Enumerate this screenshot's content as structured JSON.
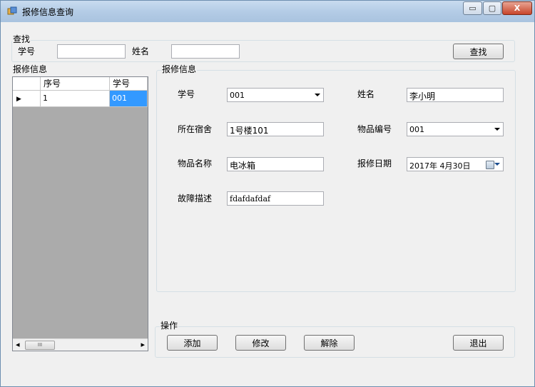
{
  "window": {
    "title": "报修信息查询",
    "controls": {
      "minimize": "▭",
      "maximize": "▢",
      "close": "X"
    }
  },
  "search": {
    "group_label": "查找",
    "student_id_label": "学号",
    "student_id_value": "",
    "name_label": "姓名",
    "name_value": "",
    "search_button": "查找"
  },
  "list": {
    "group_label": "报修信息",
    "columns": [
      "序号",
      "学号"
    ],
    "rows": [
      {
        "seq": "1",
        "student_id": "001"
      }
    ],
    "row_indicator": "▶",
    "scroll_left": "◂",
    "scroll_right": "▸",
    "scroll_thumb": "III"
  },
  "detail": {
    "group_label": "报修信息",
    "student_id_label": "学号",
    "student_id_value": "001",
    "name_label": "姓名",
    "name_value": "李小明",
    "dorm_label": "所在宿舍",
    "dorm_value": "1号楼101",
    "item_code_label": "物品编号",
    "item_code_value": "001",
    "item_name_label": "物品名称",
    "item_name_value": "电冰箱",
    "repair_date_label": "报修日期",
    "repair_date_value": "2017年  4月30日",
    "fault_label": "故障描述",
    "fault_value": "fdafdafdaf"
  },
  "actions": {
    "group_label": "操作",
    "add": "添加",
    "edit": "修改",
    "delete": "解除",
    "exit": "退出"
  },
  "colors": {
    "selection": "#3399ff",
    "grid_background": "#ababab",
    "form_background": "#f0f0f0"
  }
}
